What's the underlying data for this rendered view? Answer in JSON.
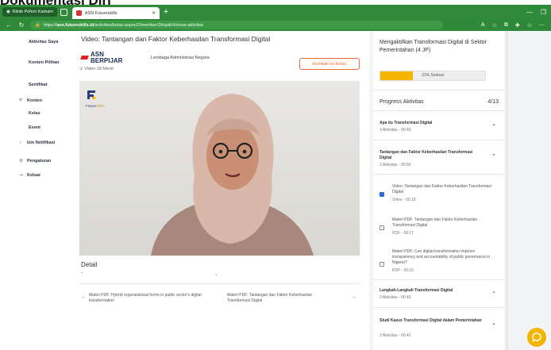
{
  "page_caption": "Dokumentasi Diri",
  "browser": {
    "profile_pill": "Klinik Pohon Kamam",
    "tab_title": "ASN Futureskills",
    "url_host": "asn.futureskills.id",
    "url_rest": "/activities/kelas-aspnc/2/member/3/topik/4/show-aktivitas",
    "url_prefix": "https://"
  },
  "sidebar": {
    "items": [
      {
        "label": "Aktivitas Saya",
        "icon": ""
      },
      {
        "label": "Konten Pilihan",
        "icon": ""
      },
      {
        "label": "Sertifikat",
        "icon": ""
      },
      {
        "label": "Konten",
        "icon": "shield-icon"
      },
      {
        "label": "Kelas",
        "icon": ""
      },
      {
        "label": "Event",
        "icon": ""
      },
      {
        "label": "Izin Notifikasi",
        "icon": "bell-icon"
      },
      {
        "label": "Pengaturan",
        "icon": "gear-icon"
      },
      {
        "label": "Keluar",
        "icon": "logout-icon"
      }
    ]
  },
  "video_header": {
    "title": "Video: Tantangan dan Faktor Keberhasilan Transformasi Digital",
    "logo_line1": "ASN",
    "logo_line2": "BERPIJAR",
    "institution": "Lembaga Administrasi Negara",
    "meta": "Video  18 Menit",
    "back_button": "Kembali ke Kelas"
  },
  "video": {
    "brand": "Future",
    "brand_accent": "Skills"
  },
  "detail": {
    "heading": "Detail",
    "body": "-"
  },
  "prev": {
    "label": "Materi PDF: Hybrid organizational forms in public sector's digital transformation"
  },
  "next": {
    "label": "Materi PDF: Tantangan dan Faktor Keberhasilan Transformasi Digital"
  },
  "course": {
    "title": "Mengaktifkan Transformasi Digital di Sektor Pemerintahan (4 JP)",
    "progress_text": "31% Selesai",
    "progress_value": 0.31,
    "progress_heading": "Progress Aktivitas",
    "progress_count": "4/13"
  },
  "modules": [
    {
      "title": "Apa itu Transformasi Digital",
      "sub": "3 Aktivitas  -  00:49"
    },
    {
      "title": "Tantangan dan Faktor Keberhasilan Transformasi Digital",
      "sub": "3 Aktivitas  -  00:50"
    },
    {
      "title": "Langkah-Langkah Transformasi Digital",
      "sub": "3 Aktivitas  -  00:49"
    },
    {
      "title": "Studi Kasus Transformasi Digital dalam Pemerintahan",
      "sub": "3 Aktivitas  -  00:42"
    }
  ],
  "activities": [
    {
      "title": "Video: Tantangan dan Faktor Keberhasilan Transformasi Digital",
      "sub": "Video  -  00:18",
      "checked": true
    },
    {
      "title": "Materi PDF: Tantangan dan Faktor Keberhasilan Transformasi Digital",
      "sub": "PDF  -  00:17",
      "checked": false
    },
    {
      "title": "Materi PDF: Can digital transformation improve transparency and accountability of public governance in Nigeria?",
      "sub": "PDF  -  00:15",
      "checked": false
    }
  ],
  "colors": {
    "brand_green": "#2f8a3a",
    "accent_orange": "#ea6b3a",
    "progress_yellow": "#f5b400",
    "check_blue": "#2f6bd8"
  }
}
